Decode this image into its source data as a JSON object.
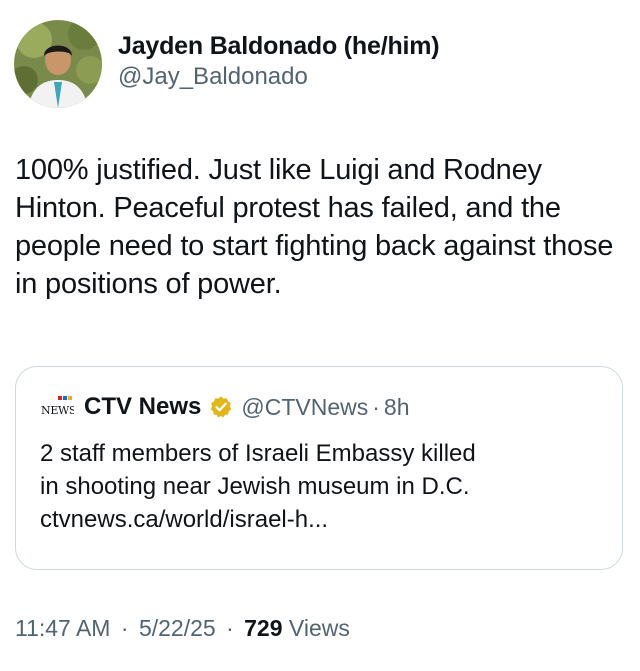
{
  "author": {
    "display_name": "Jayden Baldonado (he/him)",
    "handle": "@Jay_Baldonado",
    "avatar_icon": "profile-photo-icon"
  },
  "tweet": {
    "text": "100% justified. Just like Luigi and Rodney Hinton. Peaceful protest has failed, and the people need to start fighting back against those in positions of power."
  },
  "quoted_tweet": {
    "logo_icon": "ctv-news-logo-icon",
    "name": "CTV News",
    "verified_icon": "gold-verified-badge-icon",
    "verified_color": "#e2b719",
    "handle": "@CTVNews",
    "separator": "·",
    "time": "8h",
    "text_line_1": "2 staff members of Israeli Embassy killed",
    "text_line_2": "in shooting near Jewish museum in D.C.",
    "text_line_3": "ctvnews.ca/world/israel-h..."
  },
  "footer": {
    "time": "11:47 AM",
    "separator": "·",
    "date": "5/22/25",
    "views_count": "729",
    "views_label": "Views"
  },
  "colors": {
    "text_primary": "#0f1419",
    "text_secondary": "#536471",
    "border": "#cfd9de"
  }
}
